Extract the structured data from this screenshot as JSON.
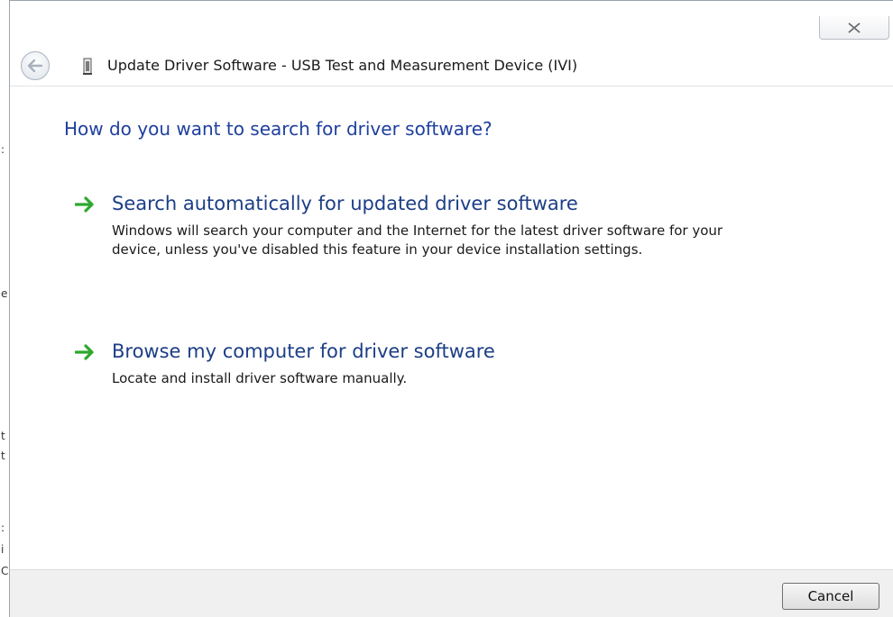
{
  "window": {
    "title": "Update Driver Software - USB Test and Measurement Device (IVI)"
  },
  "main": {
    "heading": "How do you want to search for driver software?",
    "options": [
      {
        "title": "Search automatically for updated driver software",
        "description": "Windows will search your computer and the Internet for the latest driver software for your device, unless you've disabled this feature in your device installation settings.",
        "icon": "green-arrow-icon"
      },
      {
        "title": "Browse my computer for driver software",
        "description": "Locate and install driver software manually.",
        "icon": "green-arrow-icon"
      }
    ]
  },
  "footer": {
    "cancel_label": "Cancel"
  },
  "colors": {
    "heading": "#1f3f9e",
    "option_title": "#1c3e86",
    "arrow": "#2ea82e",
    "footer_bg": "#f0f0f0"
  }
}
